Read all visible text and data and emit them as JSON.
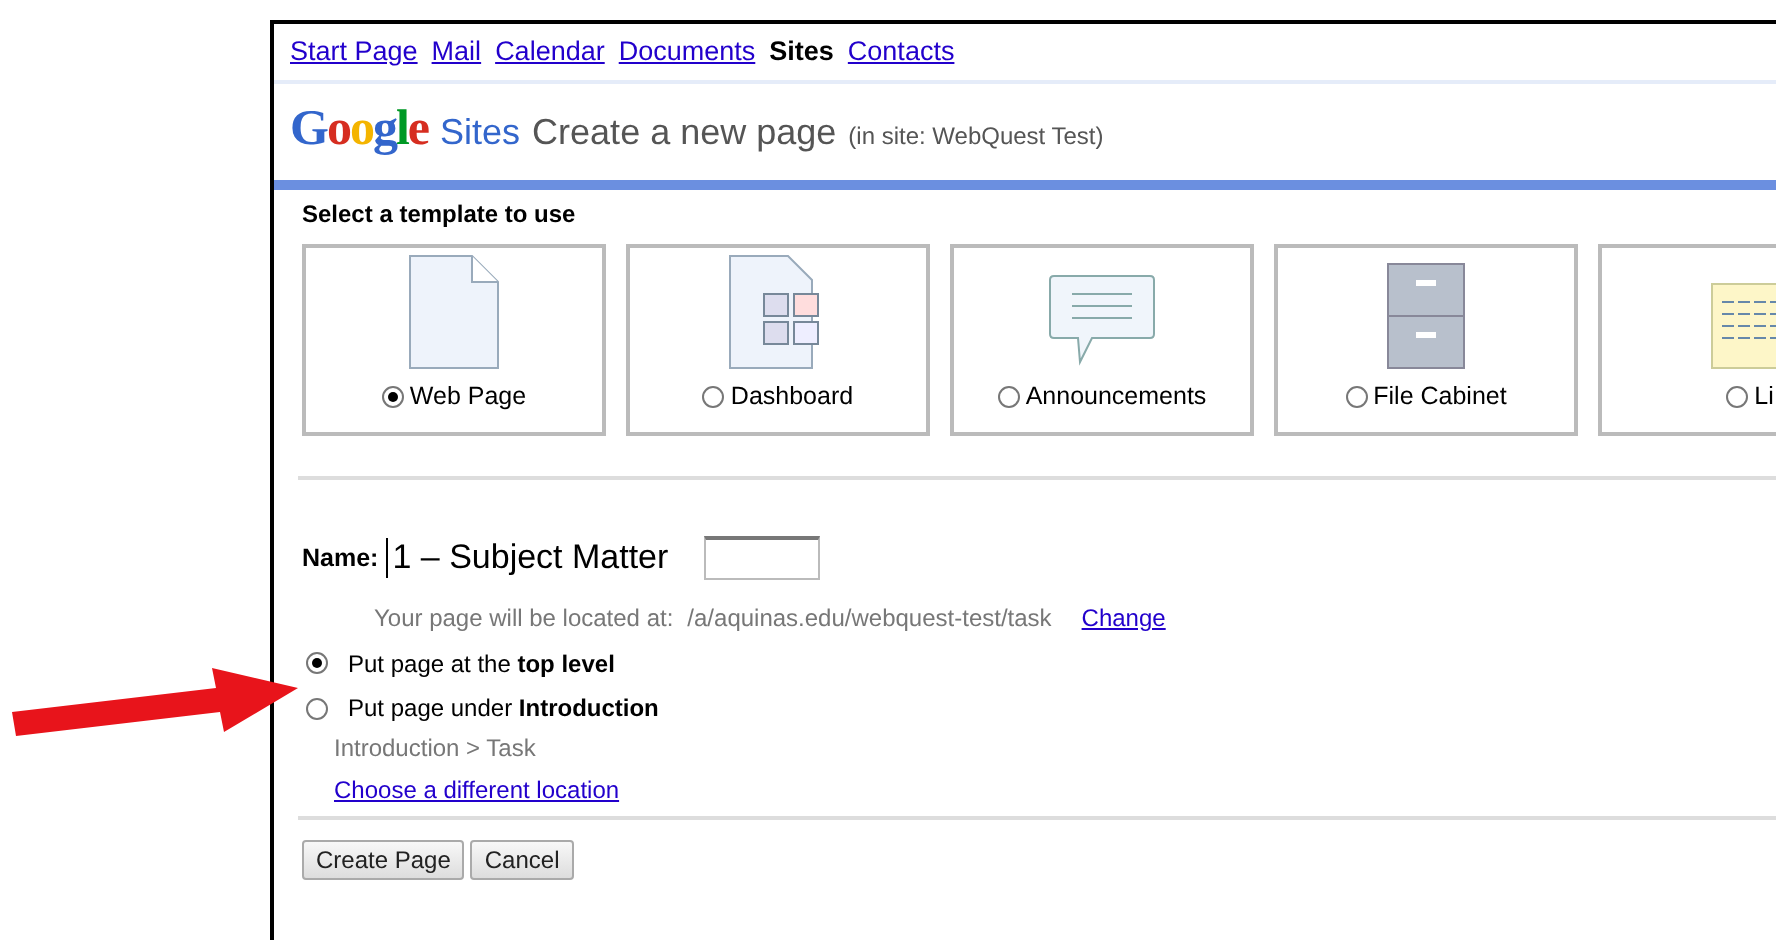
{
  "nav": [
    {
      "label": "Start Page",
      "selected": false
    },
    {
      "label": "Mail",
      "selected": false
    },
    {
      "label": "Calendar",
      "selected": false
    },
    {
      "label": "Documents",
      "selected": false
    },
    {
      "label": "Sites",
      "selected": true
    },
    {
      "label": "Contacts",
      "selected": false
    }
  ],
  "header": {
    "logo": "Google",
    "product": "Sites",
    "title": "Create a new page",
    "site_note": "(in site: WebQuest Test)"
  },
  "templates_heading": "Select a template to use",
  "templates": [
    {
      "kind": "page",
      "label": "Web Page",
      "selected": true
    },
    {
      "kind": "dashboard",
      "label": "Dashboard",
      "selected": false
    },
    {
      "kind": "announcements",
      "label": "Announcements",
      "selected": false
    },
    {
      "kind": "cabinet",
      "label": "File Cabinet",
      "selected": false
    },
    {
      "kind": "list",
      "label": "Li",
      "selected": false
    }
  ],
  "name": {
    "label": "Name:",
    "typed": "1 – Subject Matter"
  },
  "location": {
    "prefix": "Your page will be located at:",
    "path": "/a/aquinas.edu/webquest-test/task",
    "change_link": "Change"
  },
  "locations": [
    {
      "label": "Put page at the **top level**",
      "selected": true
    },
    {
      "label": "Put page under **Introduction**",
      "selected": false
    }
  ],
  "breadcrumb": "Introduction > Task",
  "choose_link": "Choose a different location",
  "buttons": [
    "Create Page",
    "Cancel"
  ]
}
